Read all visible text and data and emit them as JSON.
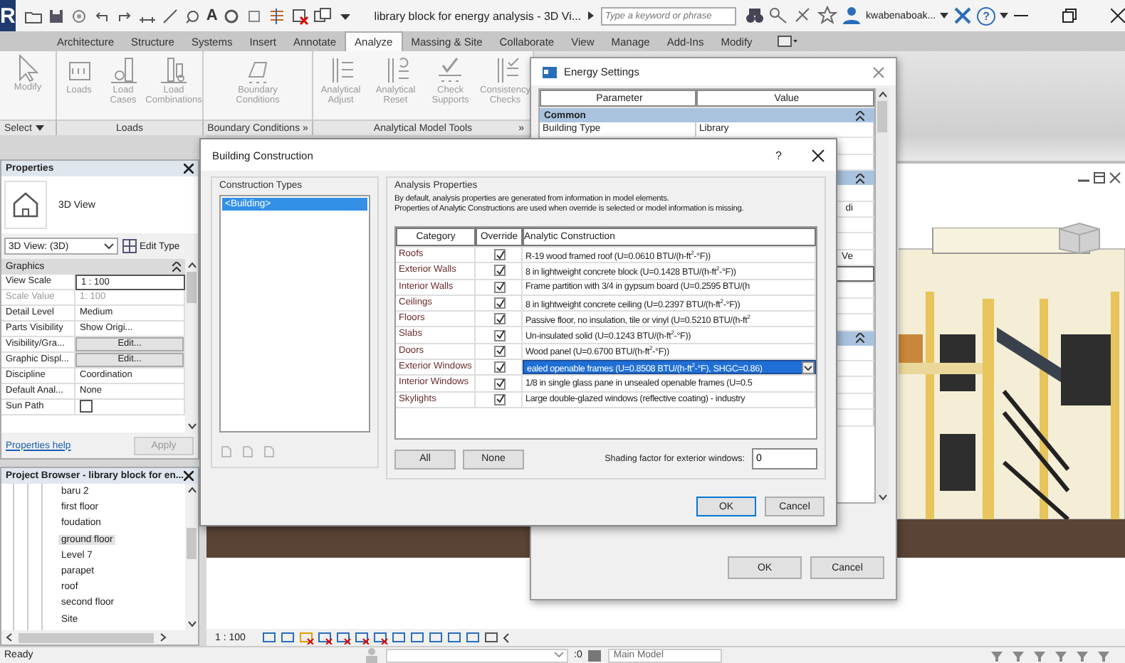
{
  "title_bar": {
    "app_button": "R",
    "text_tool": "A",
    "title": "library block for energy analysis - 3D Vi...",
    "search": {
      "placeholder": "Type a keyword or phrase"
    },
    "user": "kwabenaboak...",
    "help": "?"
  },
  "ribbon_tabs": [
    {
      "label": "Architecture",
      "selected": false
    },
    {
      "label": "Structure",
      "selected": false
    },
    {
      "label": "Systems",
      "selected": false
    },
    {
      "label": "Insert",
      "selected": false
    },
    {
      "label": "Annotate",
      "selected": false
    },
    {
      "label": "Analyze",
      "selected": true
    },
    {
      "label": "Massing & Site",
      "selected": false
    },
    {
      "label": "Collaborate",
      "selected": false
    },
    {
      "label": "View",
      "selected": false
    },
    {
      "label": "Manage",
      "selected": false
    },
    {
      "label": "Add-Ins",
      "selected": false
    },
    {
      "label": "Modify",
      "selected": false
    }
  ],
  "ribbon_panels": [
    {
      "label": "Select",
      "dropdown": true,
      "tools": [
        "Modify"
      ]
    },
    {
      "label": "Loads",
      "dropdown": false,
      "tools": [
        "Loads",
        "Load Cases",
        "Load Combinations"
      ]
    },
    {
      "label": "Boundary Conditions »",
      "dropdown": false,
      "tools": [
        "Boundary Conditions"
      ]
    },
    {
      "label": "Analytical Model Tools",
      "expander": "»",
      "dropdown": false,
      "tools": [
        "Analytical Adjust",
        "Analytical Reset",
        "Check Supports",
        "Consistency Checks"
      ]
    }
  ],
  "properties": {
    "title": "Properties",
    "type_name": "3D View",
    "type_selector": "3D View: (3D)",
    "edit_type": "Edit Type",
    "group": "Graphics",
    "rows": [
      {
        "kind": "field",
        "name": "View Scale",
        "value": "1 : 100"
      },
      {
        "kind": "readonly",
        "name": "Scale Value",
        "value": "1: 100"
      },
      {
        "kind": "text",
        "name": "Detail Level",
        "value": "Medium"
      },
      {
        "kind": "text",
        "name": "Parts Visibility",
        "value": "Show Origi..."
      },
      {
        "kind": "button",
        "name": "Visibility/Gra...",
        "value": "Edit..."
      },
      {
        "kind": "button",
        "name": "Graphic Displ...",
        "value": "Edit..."
      },
      {
        "kind": "text",
        "name": "Discipline",
        "value": "Coordination"
      },
      {
        "kind": "text",
        "name": "Default Anal...",
        "value": "None"
      },
      {
        "kind": "checkbox",
        "name": "Sun Path",
        "checked": false
      }
    ],
    "help_link": "Properties help",
    "apply": "Apply"
  },
  "project_browser": {
    "title": "Project Browser - library block for en...",
    "items": [
      {
        "label": "baru 2",
        "selected": false
      },
      {
        "label": "first floor",
        "selected": false
      },
      {
        "label": "foudation",
        "selected": false
      },
      {
        "label": "ground floor",
        "selected": true
      },
      {
        "label": "Level 7",
        "selected": false
      },
      {
        "label": "parapet",
        "selected": false
      },
      {
        "label": "roof",
        "selected": false
      },
      {
        "label": "second floor",
        "selected": false
      },
      {
        "label": "Site",
        "selected": false
      }
    ]
  },
  "view_bar": {
    "scale": "1 : 100"
  },
  "status_bar": {
    "text": "Ready",
    "worksets": ":0",
    "model": "Main Model"
  },
  "energy_settings": {
    "title": "Energy Settings",
    "columns": [
      "Parameter",
      "Value"
    ],
    "rows": [
      {
        "kind": "group",
        "label": "Common"
      },
      {
        "kind": "row",
        "parameter": "Building Type",
        "value": "Library"
      },
      {
        "kind": "row"
      },
      {
        "kind": "row"
      },
      {
        "kind": "group"
      },
      {
        "kind": "row"
      },
      {
        "kind": "tail",
        "value": "di"
      },
      {
        "kind": "row"
      },
      {
        "kind": "row"
      },
      {
        "kind": "tail",
        "value": "Ve"
      },
      {
        "kind": "field"
      },
      {
        "kind": "row"
      },
      {
        "kind": "row"
      },
      {
        "kind": "row"
      },
      {
        "kind": "group"
      },
      {
        "kind": "row"
      },
      {
        "kind": "row"
      },
      {
        "kind": "row"
      },
      {
        "kind": "row"
      },
      {
        "kind": "row"
      }
    ],
    "buttons": [
      "OK",
      "Cancel"
    ]
  },
  "building_construction": {
    "title": "Building Construction",
    "help": "?",
    "types_label": "Construction Types",
    "types": [
      {
        "label": "<Building>",
        "selected": true
      }
    ],
    "analysis_label": "Analysis Properties",
    "description": [
      "By default, analysis properties are generated from information in model elements.",
      "Properties of Analytic Constructions are used when override is selected or model information is missing."
    ],
    "columns": [
      "Category",
      "Override",
      "Analytic Construction"
    ],
    "rows": [
      {
        "category": "Roofs",
        "override": true,
        "construction": "R-19 wood framed roof (U=0.0610 BTU/(h-ft$^{2}$-°F))",
        "selected": false
      },
      {
        "category": "Exterior Walls",
        "override": true,
        "construction": "8 in lightweight concrete block (U=0.1428 BTU/(h-ft$^{2}$-°F))",
        "selected": false
      },
      {
        "category": "Interior Walls",
        "override": true,
        "construction": "Frame partition with 3/4 in gypsum board (U=0.2595 BTU/(h",
        "selected": false
      },
      {
        "category": "Ceilings",
        "override": true,
        "construction": "8 in lightweight concrete ceiling (U=0.2397 BTU/(h-ft$^{2}$-°F))",
        "selected": false
      },
      {
        "category": "Floors",
        "override": true,
        "construction": "Passive floor, no insulation, tile or vinyl (U=0.5210 BTU/(h-ft$^{2}$",
        "selected": false
      },
      {
        "category": "Slabs",
        "override": true,
        "construction": "Un-insulated solid (U=0.1243 BTU/(h-ft$^{2}$-°F))",
        "selected": false
      },
      {
        "category": "Doors",
        "override": true,
        "construction": "Wood panel (U=0.6700 BTU/(h-ft$^{2}$-°F))",
        "selected": false
      },
      {
        "category": "Exterior Windows",
        "override": true,
        "construction": "ealed openable frames (U=0.8508 BTU/(h-ft$^{2}$-°F), SHGC=0.86)",
        "selected": true
      },
      {
        "category": "Interior Windows",
        "override": true,
        "construction": "1/8 in single glass pane in unsealed openable frames (U=0.5",
        "selected": false
      },
      {
        "category": "Skylights",
        "override": true,
        "construction": "Large double-glazed windows (reflective coating) - industry",
        "selected": false
      }
    ],
    "all_button": "All",
    "none_button": "None",
    "shading_label": "Shading factor for exterior windows:",
    "shading_value": "0",
    "ok": "OK",
    "cancel": "Cancel"
  }
}
